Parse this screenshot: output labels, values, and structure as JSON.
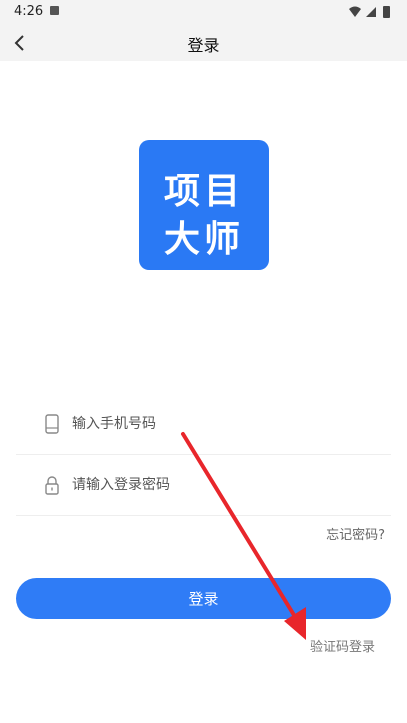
{
  "status_bar": {
    "time": "4:26"
  },
  "header": {
    "title": "登录",
    "back_icon": "chevron-left-icon"
  },
  "logo": {
    "line1": "项目",
    "line2": "大师",
    "color": "#2a79f4"
  },
  "form": {
    "phone_placeholder": "输入手机号码",
    "phone_icon": "phone-icon",
    "password_placeholder": "请输入登录密码",
    "password_icon": "lock-icon",
    "forgot_password": "忘记密码?"
  },
  "actions": {
    "login_label": "登录",
    "login_color": "#2f7cf6",
    "sms_login_label": "验证码登录"
  },
  "annotation": {
    "arrow_color": "#e8262b"
  }
}
